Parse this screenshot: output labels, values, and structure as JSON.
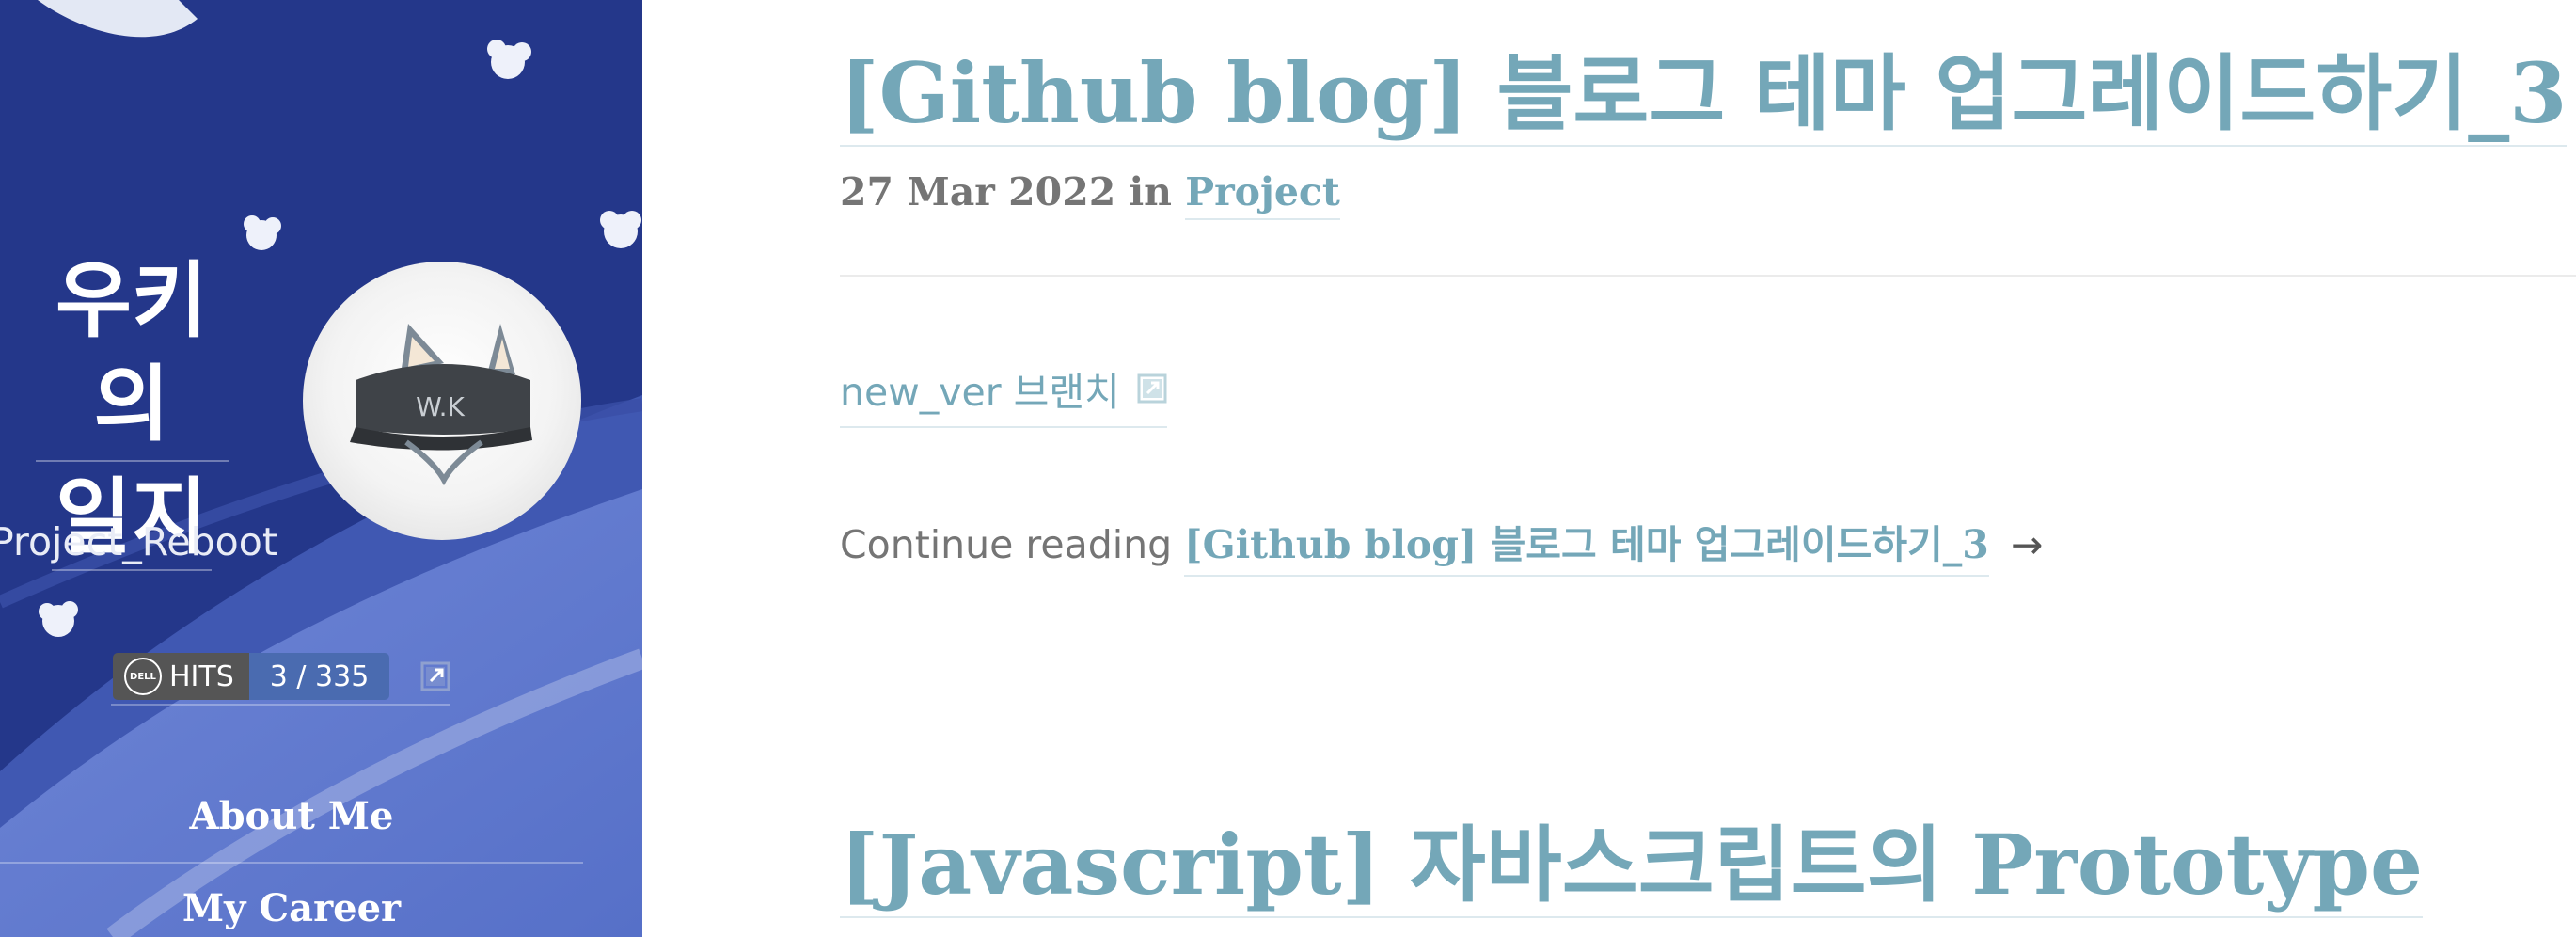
{
  "sidebar": {
    "title_line1": "우키의",
    "title_line2": "일지",
    "tagline": "Project_Reboot",
    "avatar_caption": "W.K",
    "hits": {
      "brand": "DELL",
      "label": "HITS",
      "value": "3 / 335"
    },
    "nav": [
      {
        "label": "About Me"
      },
      {
        "label": "My Career"
      }
    ]
  },
  "posts": [
    {
      "title": "[Github blog] 블로그 테마 업그레이드하기_3",
      "date": "27 Mar 2022",
      "in_word": "in",
      "category": "Project",
      "excerpt_link": "new_ver 브랜치",
      "continue_prefix": "Continue reading",
      "continue_link": "[Github blog] 블로그 테마 업그레이드하기_3",
      "arrow": "→"
    },
    {
      "title": "[Javascript] 자바스크립트의 Prototype"
    }
  ],
  "colors": {
    "sidebar_bg": "#24378a",
    "accent": "#74a7b8",
    "meta_text": "#757575"
  },
  "icons": [
    "external-link-icon",
    "dell-logo-icon",
    "cat-cap-avatar"
  ]
}
